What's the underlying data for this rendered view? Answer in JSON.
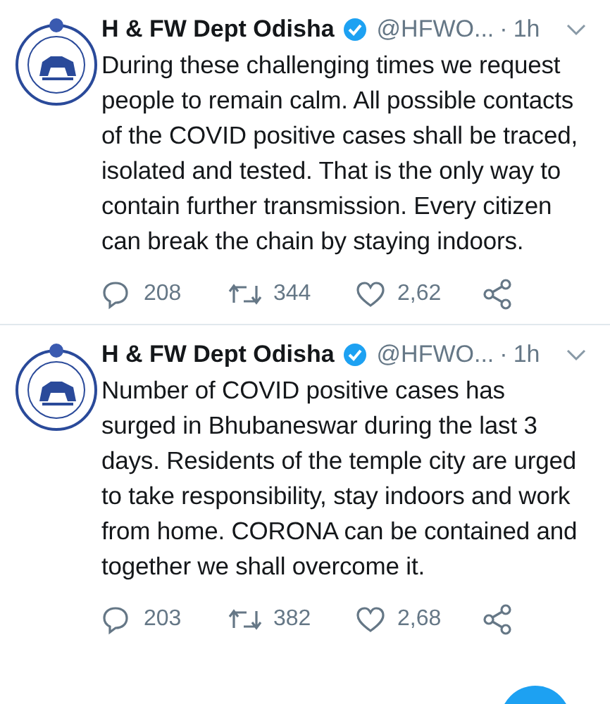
{
  "tweets": [
    {
      "name": "H & FW Dept Odisha",
      "verified": true,
      "handle": "@HFWO...",
      "separator": "·",
      "time": "1h",
      "text": "During these challenging times we request people to remain calm. All possible contacts of the COVID positive cases shall be traced, isolated and tested. That is the only way to contain further transmission. Every citizen can break the chain by staying indoors.",
      "replies": "208",
      "retweets": "344",
      "likes": "2,62"
    },
    {
      "name": "H & FW Dept Odisha",
      "verified": true,
      "handle": "@HFWO...",
      "separator": "·",
      "time": "1h",
      "text": "Number of COVID positive cases has surged in Bhubaneswar during the last 3 days. Residents of the temple city are urged to take responsibility, stay indoors and work from home. CORONA can be contained and together we shall overcome it.",
      "replies": "203",
      "retweets": "382",
      "likes": "2,68"
    }
  ]
}
